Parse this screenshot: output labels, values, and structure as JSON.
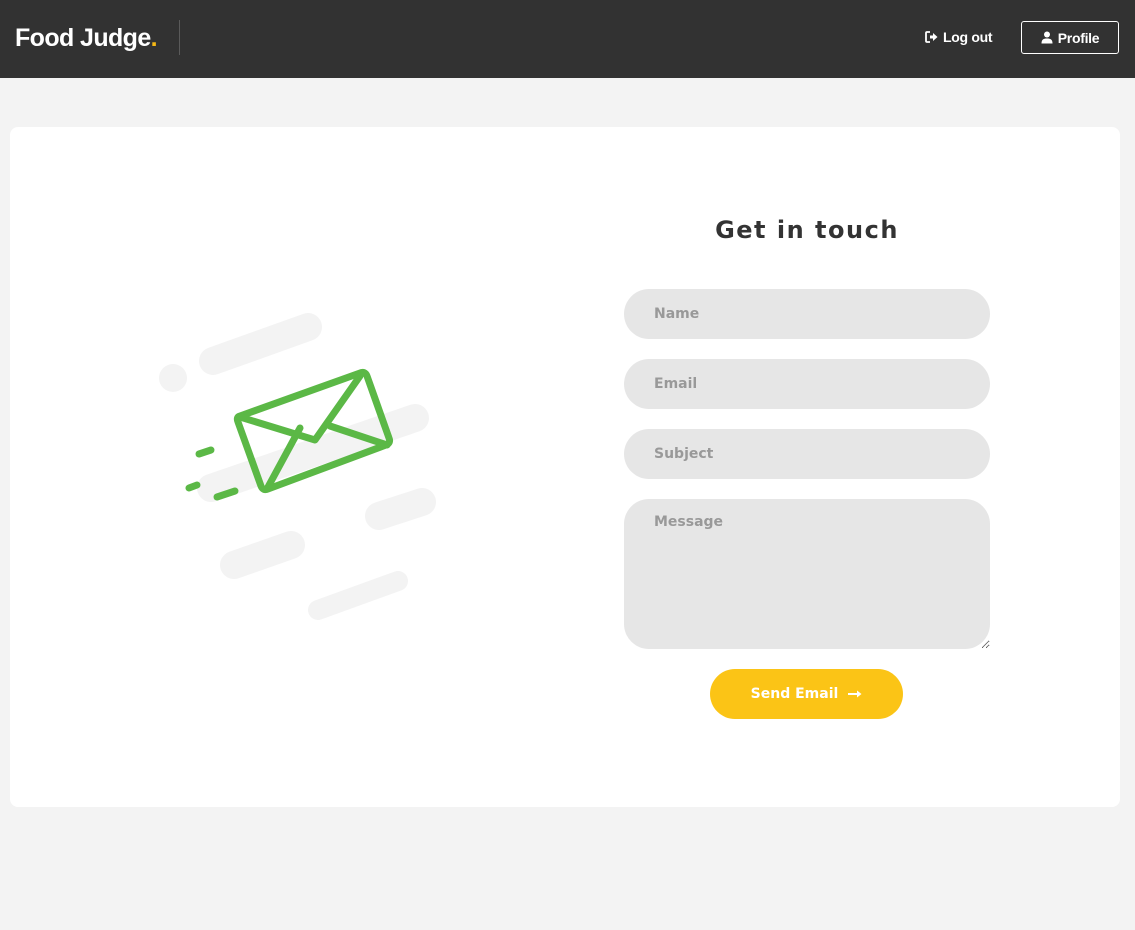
{
  "navbar": {
    "brand": "Food Judge",
    "brand_dot": ".",
    "logout_label": "Log out",
    "profile_label": "Profile"
  },
  "contact": {
    "title": "Get in touch",
    "name_placeholder": "Name",
    "email_placeholder": "Email",
    "subject_placeholder": "Subject",
    "message_placeholder": "Message",
    "send_label": "Send Email"
  },
  "colors": {
    "navbar_bg": "#323232",
    "accent_yellow": "#fbc416",
    "envelope_green": "#5bb846",
    "field_bg": "#e6e6e6",
    "page_bg": "#f3f3f3"
  }
}
